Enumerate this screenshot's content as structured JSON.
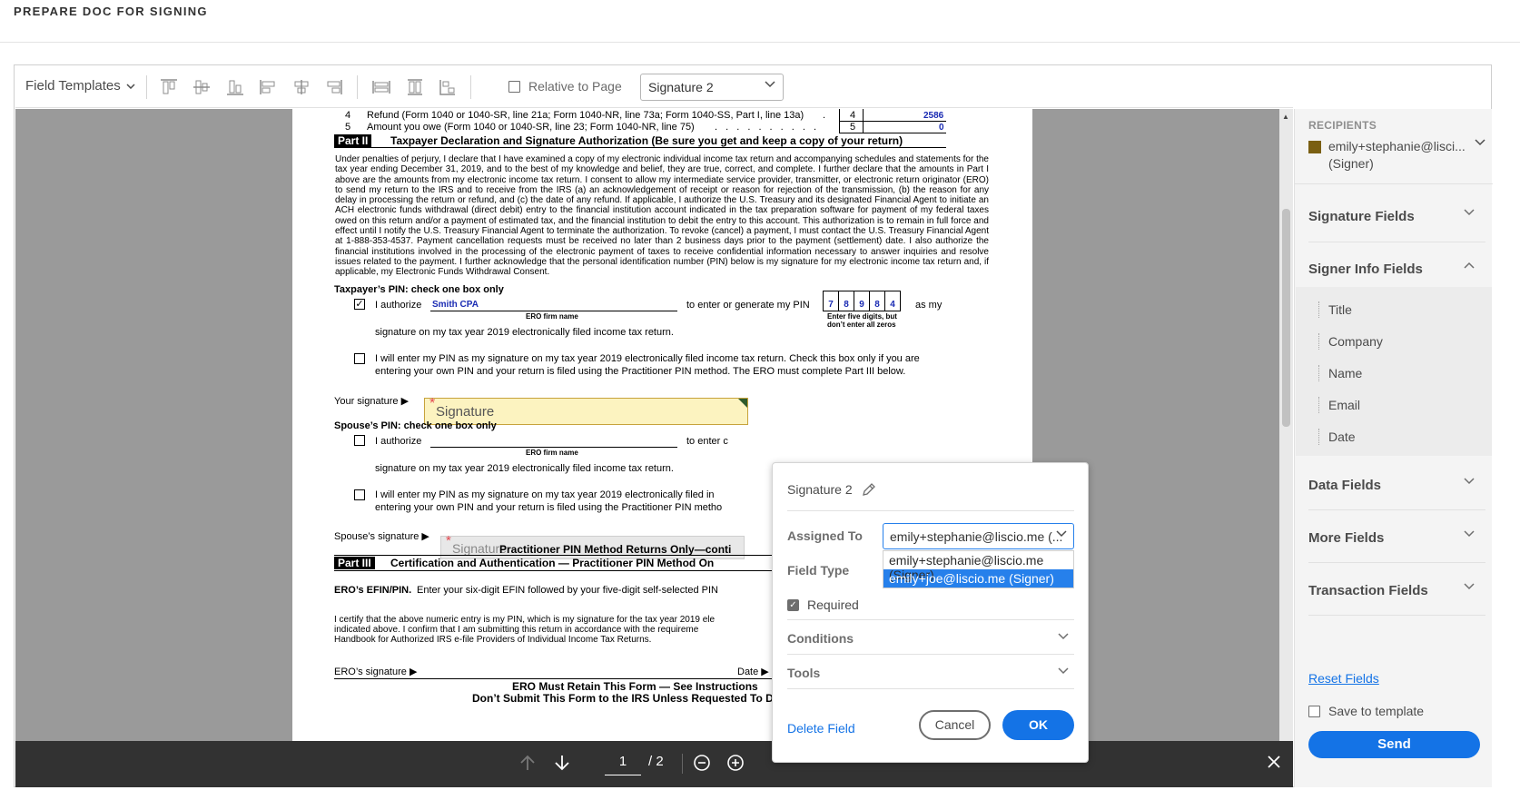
{
  "header": {
    "title": "PREPARE DOC FOR SIGNING"
  },
  "toolbar": {
    "field_templates": "Field Templates",
    "relative_to_page": "Relative to Page",
    "field_select_value": "Signature 2"
  },
  "document": {
    "line4_num": "4",
    "line4_text": "Refund (Form 1040 or 1040-SR, line 21a; Form 1040-NR, line 73a; Form 1040-SS, Part I, line 13a)",
    "line4_dot": ".",
    "line4_box": "4",
    "line4_val": "2586",
    "line5_num": "5",
    "line5_text": "Amount you owe (Form 1040 or 1040-SR, line 23; Form 1040-NR, line 75)",
    "line5_dots": ". . . . . . . . . .",
    "line5_box": "5",
    "line5_val": "0",
    "part2_tag": "Part II",
    "part2_title": "Taxpayer Declaration and Signature Authorization (Be sure you get and keep a copy of your return)",
    "para": "Under penalties of perjury, I declare that I have examined a copy of my electronic individual income tax return and accompanying schedules and statements for the tax year ending December 31, 2019, and to the best of my knowledge and belief, they are true, correct, and complete. I further declare that the amounts in Part I above are the amounts from my electronic income tax return. I consent to allow my intermediate service provider, transmitter, or electronic return originator (ERO) to send my return to the IRS and to receive from the IRS (a) an acknowledgement of receipt or reason for rejection of the transmission, (b) the reason for any delay in processing the return or refund, and (c) the date of any refund. If applicable, I authorize the U.S. Treasury and its designated Financial Agent to initiate an ACH electronic funds withdrawal (direct debit) entry to the financial institution account indicated in the tax preparation software for payment of my federal taxes owed on this return and/or a payment of estimated tax, and the financial institution to debit the entry to this account. This authorization is to remain in full force and effect until I notify the U.S. Treasury Financial Agent to terminate the authorization. To revoke (cancel) a payment, I must contact the U.S. Treasury Financial Agent at 1-888-353-4537. Payment cancellation requests must be received no later than 2 business days prior to the payment (settlement) date. I also authorize the financial institutions involved in the processing of the electronic payment of taxes to receive confidential information necessary to answer inquiries and resolve issues related to the payment. I further acknowledge that the personal identification number (PIN) below is my signature for my electronic income tax return and, if applicable, my Electronic Funds Withdrawal Consent.",
    "taxpayer_pin_head": "Taxpayer’s PIN: check one box only",
    "check_mark": "✓",
    "i_authorize": "I authorize",
    "ero_name": "Smith CPA",
    "ero_firm_label": "ERO firm name",
    "to_enter": "to enter or generate my PIN",
    "pin_digits": [
      "7",
      "8",
      "9",
      "8",
      "4"
    ],
    "as_my": "as my",
    "five_digits_note_1": "Enter five digits, but",
    "five_digits_note_2": "don’t enter all zeros",
    "sig_on_return": "signature on my tax year 2019 electronically filed income tax return.",
    "will_enter_1": "I will enter my PIN as my signature on my tax year 2019 electronically filed income tax return. Check this box only if you are",
    "will_enter_2": "entering your own PIN and your return is filed using the Practitioner PIN method. The ERO must complete Part III below.",
    "your_signature": "Your signature ▶",
    "sig_field_label": "Signature",
    "required_star": "*",
    "spouse_pin_head": "Spouse’s PIN: check one box only",
    "i_authorize_2": "I authorize",
    "ero_firm_label_2": "ERO firm name",
    "to_enter_2": "to enter c",
    "sig_on_return_2": "signature on my tax year 2019 electronically filed income tax return.",
    "will_enter_s1": "I will enter my PIN as my signature on my tax year 2019 electronically filed in",
    "will_enter_s2": "entering your own PIN and your return is filed using the Practitioner PIN metho",
    "spouse_signature": "Spouse’s signature ▶",
    "sig_field2_label": "Signature",
    "practitioner_only": "Practitioner PIN Method Returns Only—conti",
    "part3_tag": "Part III",
    "part3_title": "Certification and Authentication — Practitioner PIN Method On",
    "ero_efin_bold": "ERO’s EFIN/PIN.",
    "ero_efin_rest": "Enter your six-digit EFIN followed by your five-digit self-selected PIN",
    "certify_1": "I certify that the above numeric entry is my PIN, which is my signature for the tax year 2019 ele",
    "certify_2": "indicated above. I confirm that I am submitting this return in accordance with the requireme",
    "certify_3": "Handbook for Authorized IRS e-file Providers of Individual Income Tax Returns.",
    "ero_signature": "ERO’s signature ▶",
    "date_label": "Date ▶",
    "retain": "ERO Must Retain This Form — See Instructions",
    "dont_submit": "Don’t Submit This Form to the IRS Unless Requested To Do So"
  },
  "pager": {
    "page": "1",
    "total": "/ 2"
  },
  "popup": {
    "field_name": "Signature 2",
    "assigned_to_label": "Assigned To",
    "assigned_value": "emily+stephanie@liscio.me (...",
    "options": [
      "emily+stephanie@liscio.me (Signer)",
      "emily+joe@liscio.me (Signer)"
    ],
    "field_type_label": "Field Type",
    "required_label": "Required",
    "conditions_label": "Conditions",
    "tools_label": "Tools",
    "delete_label": "Delete Field",
    "cancel_label": "Cancel",
    "ok_label": "OK"
  },
  "sidebar": {
    "recipients_head": "RECIPIENTS",
    "recipient_line1": "emily+stephanie@lisci...",
    "recipient_line2": "(Signer)",
    "recipient_color": "#7a5f12",
    "sections": {
      "signature_fields": "Signature Fields",
      "signer_info_fields": "Signer Info Fields",
      "data_fields": "Data Fields",
      "more_fields": "More Fields",
      "transaction_fields": "Transaction Fields"
    },
    "signer_info_items": [
      "Title",
      "Company",
      "Name",
      "Email",
      "Date"
    ],
    "reset_fields": "Reset Fields",
    "save_to_template": "Save to template",
    "send": "Send"
  },
  "colors": {
    "accent": "#1473e6",
    "sig_field_bg": "#fcf3c0",
    "pager_bg": "#323232"
  }
}
